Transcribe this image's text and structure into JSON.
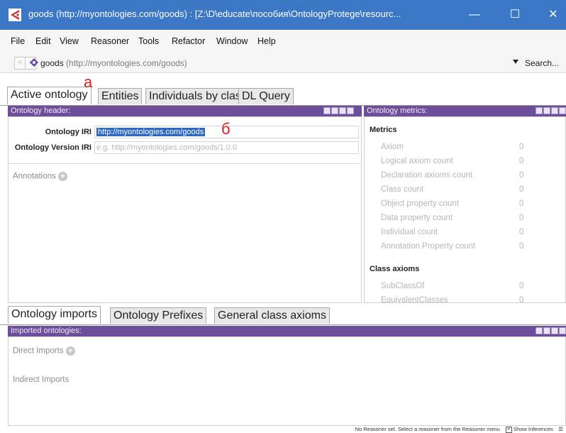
{
  "window": {
    "title": "goods (http://myontologies.com/goods)  : [Z:\\D\\educate\\пособия\\OntologyProtege\\resourc...",
    "controls": {
      "minimize": "—",
      "maximize": "☐",
      "close": "✕"
    }
  },
  "menu": [
    "File",
    "Edit",
    "View",
    "Reasoner",
    "Tools",
    "Refactor",
    "Window",
    "Help"
  ],
  "nav": {
    "back": "<",
    "forward": ">",
    "ontology_name": "goods",
    "ontology_iri": "(http://myontologies.com/goods)",
    "search_label": "Search..."
  },
  "top_tabs": [
    "Active ontology",
    "Entities",
    "Individuals by class",
    "DL Query"
  ],
  "annotations": {
    "a": "а",
    "b": "б"
  },
  "ontology_header": {
    "title": "Ontology header:",
    "iri_label": "Ontology IRI",
    "iri_value": "http://myontologies.com/goods",
    "version_label": "Ontology Version IRI",
    "version_placeholder": "e.g. http://myontologies.com/goods/1.0.0",
    "annotations_label": "Annotations"
  },
  "metrics_panel": {
    "title": "Ontology metrics:",
    "section_metrics": "Metrics",
    "rows": [
      {
        "label": "Axiom",
        "value": "0"
      },
      {
        "label": "Logical axiom count",
        "value": "0"
      },
      {
        "label": "Declaration axioms count",
        "value": "0"
      },
      {
        "label": "Class count",
        "value": "0"
      },
      {
        "label": "Object property count",
        "value": "0"
      },
      {
        "label": "Data property count",
        "value": "0"
      },
      {
        "label": "Individual count",
        "value": "0"
      },
      {
        "label": "Annotation Property count",
        "value": "0"
      }
    ],
    "section_class_axioms": "Class axioms",
    "class_rows": [
      {
        "label": "SubClassOf",
        "value": "0"
      },
      {
        "label": "EquivalentClasses",
        "value": "0"
      }
    ]
  },
  "bottom_tabs": [
    "Ontology imports",
    "Ontology Prefixes",
    "General class axioms"
  ],
  "imports_panel": {
    "title": "Imported ontologies:",
    "direct": "Direct Imports",
    "indirect": "Indirect Imports"
  },
  "status": {
    "reasoner": "No Reasoner set. Select a reasoner from the Reasoner menu",
    "show_inferences": "Show Inferences"
  },
  "colors": {
    "titlebar": "#3c77c6",
    "panel_header": "#6c4e9b",
    "selection": "#2e68c0",
    "annotation": "#e21d1d"
  }
}
